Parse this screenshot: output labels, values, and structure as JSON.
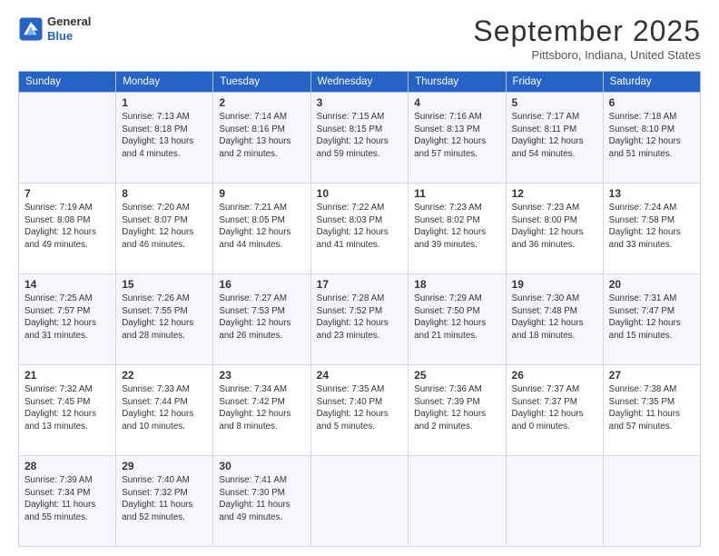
{
  "header": {
    "logo": {
      "line1": "General",
      "line2": "Blue"
    },
    "title": "September 2025",
    "location": "Pittsboro, Indiana, United States"
  },
  "calendar": {
    "weekdays": [
      "Sunday",
      "Monday",
      "Tuesday",
      "Wednesday",
      "Thursday",
      "Friday",
      "Saturday"
    ],
    "weeks": [
      [
        {
          "day": "",
          "content": ""
        },
        {
          "day": "1",
          "content": "Sunrise: 7:13 AM\nSunset: 8:18 PM\nDaylight: 13 hours\nand 4 minutes."
        },
        {
          "day": "2",
          "content": "Sunrise: 7:14 AM\nSunset: 8:16 PM\nDaylight: 13 hours\nand 2 minutes."
        },
        {
          "day": "3",
          "content": "Sunrise: 7:15 AM\nSunset: 8:15 PM\nDaylight: 12 hours\nand 59 minutes."
        },
        {
          "day": "4",
          "content": "Sunrise: 7:16 AM\nSunset: 8:13 PM\nDaylight: 12 hours\nand 57 minutes."
        },
        {
          "day": "5",
          "content": "Sunrise: 7:17 AM\nSunset: 8:11 PM\nDaylight: 12 hours\nand 54 minutes."
        },
        {
          "day": "6",
          "content": "Sunrise: 7:18 AM\nSunset: 8:10 PM\nDaylight: 12 hours\nand 51 minutes."
        }
      ],
      [
        {
          "day": "7",
          "content": "Sunrise: 7:19 AM\nSunset: 8:08 PM\nDaylight: 12 hours\nand 49 minutes."
        },
        {
          "day": "8",
          "content": "Sunrise: 7:20 AM\nSunset: 8:07 PM\nDaylight: 12 hours\nand 46 minutes."
        },
        {
          "day": "9",
          "content": "Sunrise: 7:21 AM\nSunset: 8:05 PM\nDaylight: 12 hours\nand 44 minutes."
        },
        {
          "day": "10",
          "content": "Sunrise: 7:22 AM\nSunset: 8:03 PM\nDaylight: 12 hours\nand 41 minutes."
        },
        {
          "day": "11",
          "content": "Sunrise: 7:23 AM\nSunset: 8:02 PM\nDaylight: 12 hours\nand 39 minutes."
        },
        {
          "day": "12",
          "content": "Sunrise: 7:23 AM\nSunset: 8:00 PM\nDaylight: 12 hours\nand 36 minutes."
        },
        {
          "day": "13",
          "content": "Sunrise: 7:24 AM\nSunset: 7:58 PM\nDaylight: 12 hours\nand 33 minutes."
        }
      ],
      [
        {
          "day": "14",
          "content": "Sunrise: 7:25 AM\nSunset: 7:57 PM\nDaylight: 12 hours\nand 31 minutes."
        },
        {
          "day": "15",
          "content": "Sunrise: 7:26 AM\nSunset: 7:55 PM\nDaylight: 12 hours\nand 28 minutes."
        },
        {
          "day": "16",
          "content": "Sunrise: 7:27 AM\nSunset: 7:53 PM\nDaylight: 12 hours\nand 26 minutes."
        },
        {
          "day": "17",
          "content": "Sunrise: 7:28 AM\nSunset: 7:52 PM\nDaylight: 12 hours\nand 23 minutes."
        },
        {
          "day": "18",
          "content": "Sunrise: 7:29 AM\nSunset: 7:50 PM\nDaylight: 12 hours\nand 21 minutes."
        },
        {
          "day": "19",
          "content": "Sunrise: 7:30 AM\nSunset: 7:48 PM\nDaylight: 12 hours\nand 18 minutes."
        },
        {
          "day": "20",
          "content": "Sunrise: 7:31 AM\nSunset: 7:47 PM\nDaylight: 12 hours\nand 15 minutes."
        }
      ],
      [
        {
          "day": "21",
          "content": "Sunrise: 7:32 AM\nSunset: 7:45 PM\nDaylight: 12 hours\nand 13 minutes."
        },
        {
          "day": "22",
          "content": "Sunrise: 7:33 AM\nSunset: 7:44 PM\nDaylight: 12 hours\nand 10 minutes."
        },
        {
          "day": "23",
          "content": "Sunrise: 7:34 AM\nSunset: 7:42 PM\nDaylight: 12 hours\nand 8 minutes."
        },
        {
          "day": "24",
          "content": "Sunrise: 7:35 AM\nSunset: 7:40 PM\nDaylight: 12 hours\nand 5 minutes."
        },
        {
          "day": "25",
          "content": "Sunrise: 7:36 AM\nSunset: 7:39 PM\nDaylight: 12 hours\nand 2 minutes."
        },
        {
          "day": "26",
          "content": "Sunrise: 7:37 AM\nSunset: 7:37 PM\nDaylight: 12 hours\nand 0 minutes."
        },
        {
          "day": "27",
          "content": "Sunrise: 7:38 AM\nSunset: 7:35 PM\nDaylight: 11 hours\nand 57 minutes."
        }
      ],
      [
        {
          "day": "28",
          "content": "Sunrise: 7:39 AM\nSunset: 7:34 PM\nDaylight: 11 hours\nand 55 minutes."
        },
        {
          "day": "29",
          "content": "Sunrise: 7:40 AM\nSunset: 7:32 PM\nDaylight: 11 hours\nand 52 minutes."
        },
        {
          "day": "30",
          "content": "Sunrise: 7:41 AM\nSunset: 7:30 PM\nDaylight: 11 hours\nand 49 minutes."
        },
        {
          "day": "",
          "content": ""
        },
        {
          "day": "",
          "content": ""
        },
        {
          "day": "",
          "content": ""
        },
        {
          "day": "",
          "content": ""
        }
      ]
    ]
  }
}
